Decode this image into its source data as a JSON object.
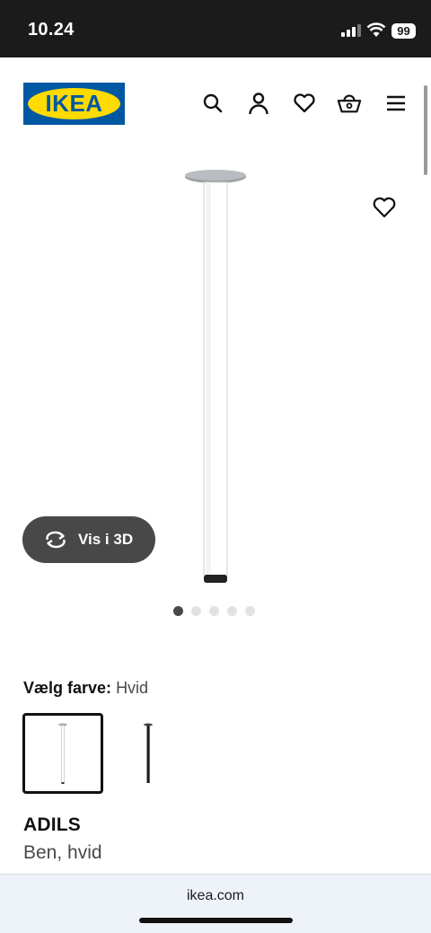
{
  "status_bar": {
    "time": "10.24",
    "battery": "99"
  },
  "header": {
    "logo_text": "IKEA"
  },
  "hero": {
    "view_3d_label": "Vis i 3D",
    "image_count": 5,
    "active_index": 0
  },
  "color_picker": {
    "label": "Vælg farve:",
    "value": "Hvid",
    "options": [
      "white",
      "black"
    ]
  },
  "product": {
    "name": "ADILS",
    "description": "Ben, hvid"
  },
  "browser": {
    "url": "ikea.com"
  },
  "colors": {
    "brand_blue": "#0058a3",
    "brand_yellow": "#ffdb00",
    "dark_button": "#484848"
  }
}
